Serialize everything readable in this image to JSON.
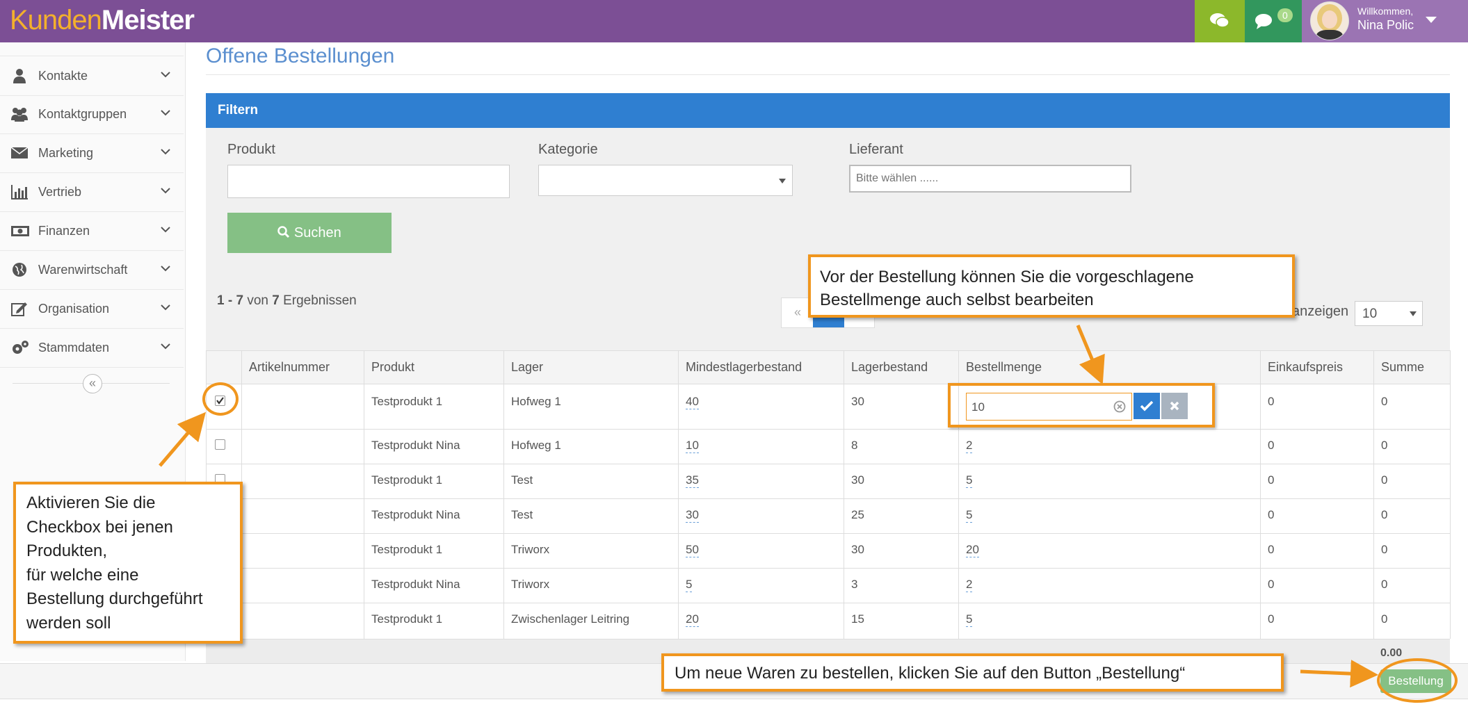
{
  "header": {
    "logo_light": "Kunden",
    "logo_bold": "Meister",
    "badge_count": "0",
    "welcome": "Willkommen,",
    "user_name": "Nina Polic"
  },
  "sidebar": {
    "items": [
      {
        "label": "Kontakte",
        "icon": "person-icon"
      },
      {
        "label": "Kontaktgruppen",
        "icon": "people-icon"
      },
      {
        "label": "Marketing",
        "icon": "envelope-icon"
      },
      {
        "label": "Vertrieb",
        "icon": "bar-chart-icon"
      },
      {
        "label": "Finanzen",
        "icon": "banknote-icon"
      },
      {
        "label": "Warenwirtschaft",
        "icon": "globe-icon"
      },
      {
        "label": "Organisation",
        "icon": "edit-icon"
      },
      {
        "label": "Stammdaten",
        "icon": "cogs-icon"
      }
    ],
    "collapse_glyph": "«"
  },
  "page": {
    "title": "Offene Bestellungen"
  },
  "filter": {
    "heading": "Filtern",
    "product_label": "Produkt",
    "product_value": "",
    "category_label": "Kategorie",
    "category_value": "",
    "supplier_label": "Lieferant",
    "supplier_placeholder": "Bitte wählen ......",
    "search_label": "Suchen"
  },
  "results": {
    "range_start": "1",
    "range_sep": " - ",
    "range_end": "7",
    "von": " von ",
    "total": "7",
    "suffix": " Ergebnissen",
    "per_page_label": "anzeigen",
    "per_page_value": "10",
    "prev_glyph": "«"
  },
  "table": {
    "headers": [
      "Artikelnummer",
      "Produkt",
      "Lager",
      "Mindestlagerbestand",
      "Lagerbestand",
      "Bestellmenge",
      "Einkaufspreis",
      "Summe"
    ],
    "rows": [
      {
        "checked": true,
        "artikelnummer": "",
        "produkt": "Testprodukt 1",
        "lager": "Hofweg 1",
        "mindest": "40",
        "bestand": "30",
        "menge": "10",
        "einkauf": "0",
        "summe": "0"
      },
      {
        "checked": false,
        "artikelnummer": "",
        "produkt": "Testprodukt Nina",
        "lager": "Hofweg 1",
        "mindest": "10",
        "bestand": "8",
        "menge": "2",
        "einkauf": "0",
        "summe": "0"
      },
      {
        "checked": false,
        "artikelnummer": "",
        "produkt": "Testprodukt 1",
        "lager": "Test",
        "mindest": "35",
        "bestand": "30",
        "menge": "5",
        "einkauf": "0",
        "summe": "0"
      },
      {
        "checked": false,
        "artikelnummer": "",
        "produkt": "Testprodukt Nina",
        "lager": "Test",
        "mindest": "30",
        "bestand": "25",
        "menge": "5",
        "einkauf": "0",
        "summe": "0"
      },
      {
        "checked": false,
        "artikelnummer": "",
        "produkt": "Testprodukt 1",
        "lager": "Triworx",
        "mindest": "50",
        "bestand": "30",
        "menge": "20",
        "einkauf": "0",
        "summe": "0"
      },
      {
        "checked": false,
        "artikelnummer": "",
        "produkt": "Testprodukt Nina",
        "lager": "Triworx",
        "mindest": "5",
        "bestand": "3",
        "menge": "2",
        "einkauf": "0",
        "summe": "0"
      },
      {
        "checked": false,
        "artikelnummer": "",
        "produkt": "Testprodukt 1",
        "lager": "Zwischenlager Leitring",
        "mindest": "20",
        "bestand": "15",
        "menge": "5",
        "einkauf": "0",
        "summe": "0"
      }
    ],
    "total_sum": "0.00"
  },
  "order_button": "Bestellung",
  "callouts": {
    "edit_quantity": [
      "Vor der Bestellung können Sie die vorgeschlagene",
      "Bestellmenge auch selbst bearbeiten"
    ],
    "checkbox": [
      "Aktivieren Sie die",
      "Checkbox bei jenen",
      "Produkten,",
      "für welche eine",
      "Bestellung durchgeführt",
      "werden soll"
    ],
    "order": "Um neue Waren zu bestellen, klicken Sie auf den Button „Bestellung“"
  },
  "colors": {
    "topbar": "#7c4f95",
    "accent_blue": "#2f7fd1",
    "callout_border": "#f0961e",
    "search_button": "#85c085"
  }
}
